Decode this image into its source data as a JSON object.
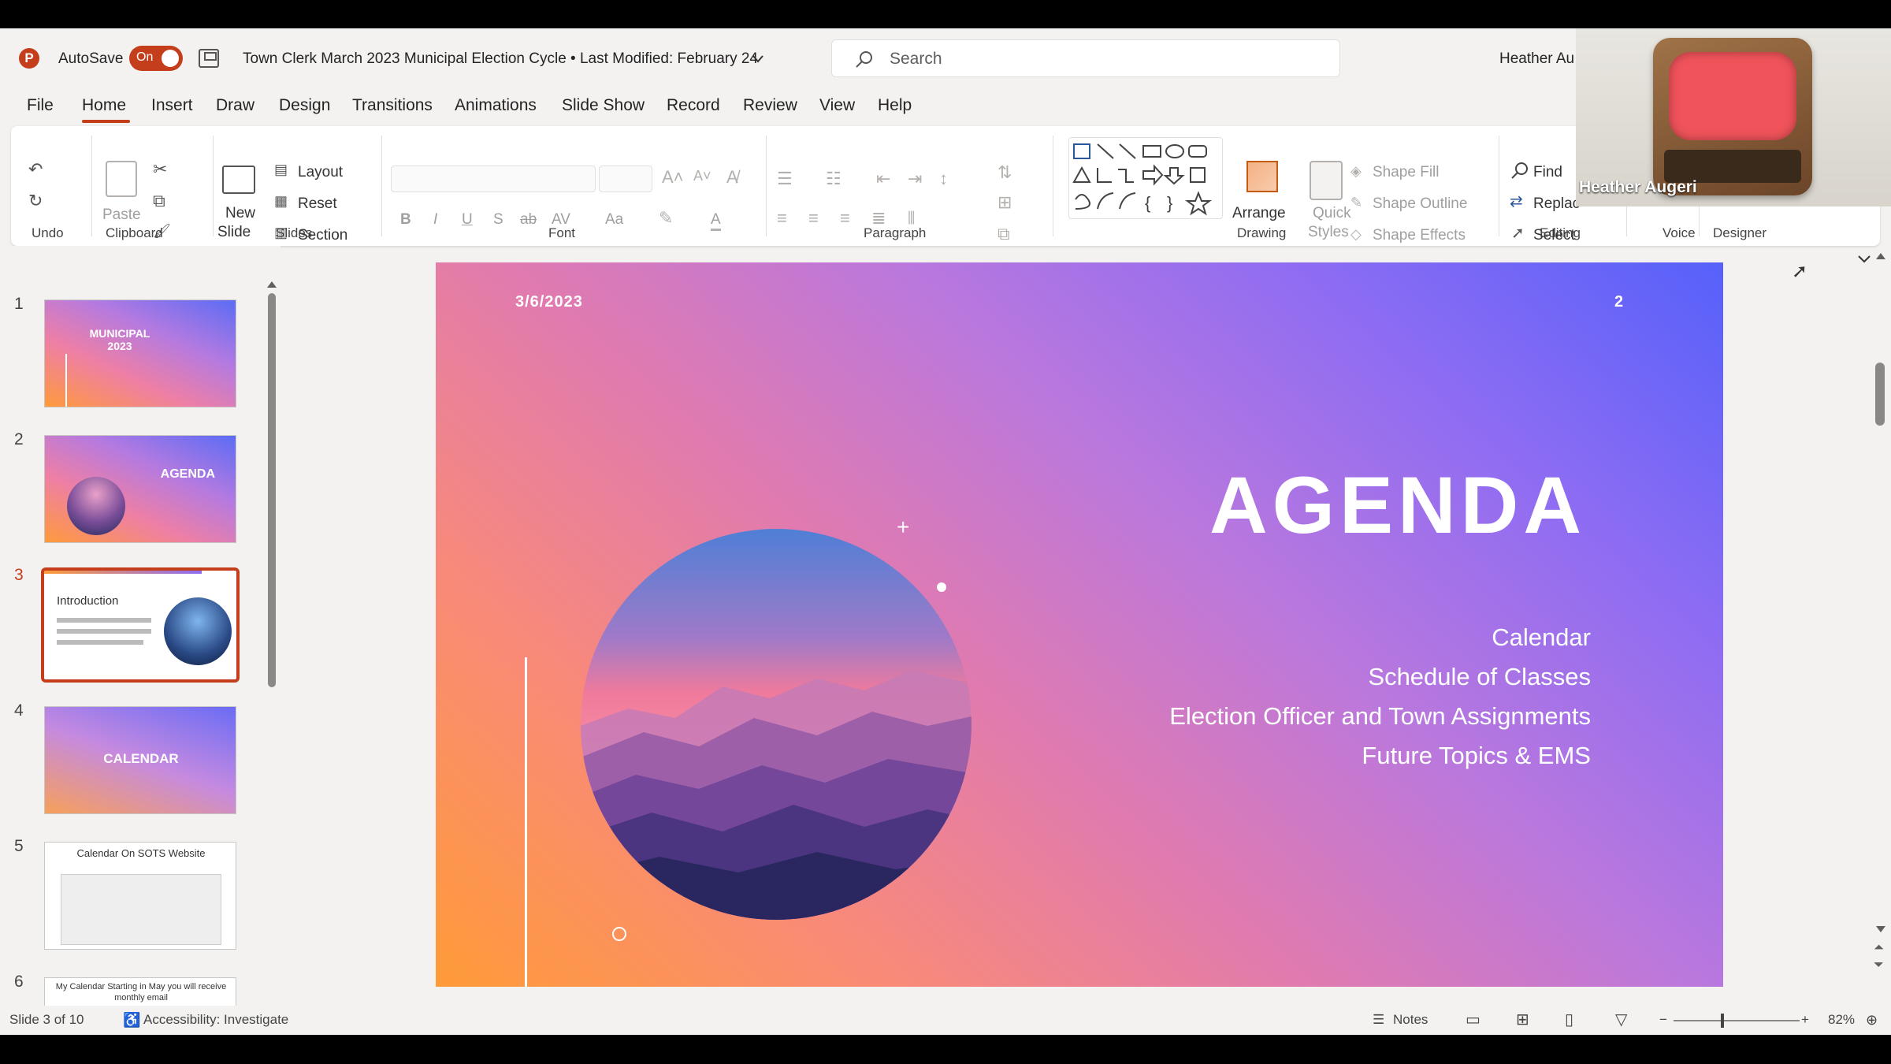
{
  "titlebar": {
    "app_logo": "P",
    "autosave_label": "AutoSave",
    "autosave_state": "On",
    "doc_title": "Town Clerk March 2023 Municipal Election Cycle • Last Modified: February 24",
    "search_placeholder": "Search",
    "user_name": "Heather Au"
  },
  "menu_tabs": [
    "File",
    "Home",
    "Insert",
    "Draw",
    "Design",
    "Transitions",
    "Animations",
    "Slide Show",
    "Record",
    "Review",
    "View",
    "Help"
  ],
  "ribbon": {
    "groups": {
      "undo": "Undo",
      "clipboard": "Clipboard",
      "slides": "Slides",
      "font": "Font",
      "paragraph": "Paragraph",
      "drawing": "Drawing",
      "editing": "Editing",
      "voice": "Voice",
      "designer": "Designer"
    },
    "paste": "Paste",
    "new_slide_1": "New",
    "new_slide_2": "Slide",
    "layout": "Layout",
    "reset": "Reset",
    "section": "Section",
    "arrange": "Arrange",
    "quick_styles_1": "Quick",
    "quick_styles_2": "Styles",
    "shape_fill": "Shape Fill",
    "shape_outline": "Shape Outline",
    "shape_effects": "Shape Effects",
    "find": "Find",
    "replace": "Replac",
    "select": "Select",
    "bold": "B",
    "italic": "I",
    "underline": "U",
    "shadow": "S",
    "strike": "ab",
    "char_spacing": "AV",
    "change_case": "Aa",
    "font_color": "A"
  },
  "thumbnails": [
    {
      "num": "1",
      "title": "MUNICIPAL\n2023"
    },
    {
      "num": "2",
      "title": "AGENDA"
    },
    {
      "num": "3",
      "title": "Introduction"
    },
    {
      "num": "4",
      "title": "CALENDAR"
    },
    {
      "num": "5",
      "title": "Calendar On SOTS Website"
    },
    {
      "num": "6",
      "title": "My Calendar Starting in May you will receive monthly email"
    }
  ],
  "slide": {
    "date": "3/6/2023",
    "number": "2",
    "title": "AGENDA",
    "items": [
      "Calendar",
      "Schedule of Classes",
      "Election Officer and Town Assignments",
      "Future Topics & EMS"
    ]
  },
  "statusbar": {
    "slide_info": "Slide 3 of 10",
    "accessibility": "Accessibility: Investigate",
    "notes": "Notes",
    "zoom": "82%"
  },
  "webcam": {
    "name": "Heather Augeri"
  },
  "colors": {
    "accent": "#c43e1c",
    "slide_gradient_start": "#ff9b38",
    "slide_gradient_end": "#5661fa"
  }
}
